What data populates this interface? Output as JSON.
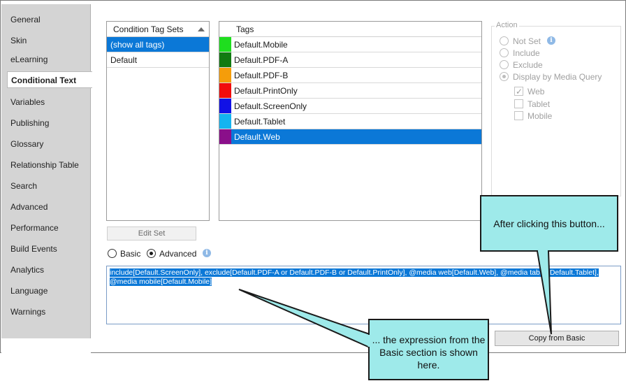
{
  "sidebar": {
    "items": [
      {
        "label": "General"
      },
      {
        "label": "Skin"
      },
      {
        "label": "eLearning"
      },
      {
        "label": "Conditional Text",
        "active": true
      },
      {
        "label": "Variables"
      },
      {
        "label": "Publishing"
      },
      {
        "label": "Glossary"
      },
      {
        "label": "Relationship Table"
      },
      {
        "label": "Search"
      },
      {
        "label": "Advanced"
      },
      {
        "label": "Performance"
      },
      {
        "label": "Build Events"
      },
      {
        "label": "Analytics"
      },
      {
        "label": "Language"
      },
      {
        "label": "Warnings"
      }
    ]
  },
  "tag_sets": {
    "header": "Condition Tag Sets",
    "rows": [
      "(show all tags)",
      "Default"
    ],
    "selected": "(show all tags)"
  },
  "tags": {
    "header": "Tags",
    "rows": [
      {
        "label": "Default.Mobile",
        "color": "#1fde1f"
      },
      {
        "label": "Default.PDF-A",
        "color": "#117a11"
      },
      {
        "label": "Default.PDF-B",
        "color": "#f59d0a"
      },
      {
        "label": "Default.PrintOnly",
        "color": "#f10c0c"
      },
      {
        "label": "Default.ScreenOnly",
        "color": "#1111e6"
      },
      {
        "label": "Default.Tablet",
        "color": "#14b4f0"
      },
      {
        "label": "Default.Web",
        "color": "#8a0f8a"
      }
    ],
    "selected": "Default.Web"
  },
  "action": {
    "legend": "Action",
    "options": [
      {
        "label": "Not Set",
        "checked": false
      },
      {
        "label": "Include",
        "checked": false
      },
      {
        "label": "Exclude",
        "checked": false
      },
      {
        "label": "Display by Media Query",
        "checked": true
      }
    ],
    "media": [
      {
        "label": "Web",
        "checked": true
      },
      {
        "label": "Tablet",
        "checked": false
      },
      {
        "label": "Mobile",
        "checked": false
      }
    ]
  },
  "edit_set_label": "Edit Set",
  "mode": {
    "basic_label": "Basic",
    "advanced_label": "Advanced",
    "selected": "Advanced"
  },
  "expression": "include[Default.ScreenOnly], exclude[Default.PDF-A or Default.PDF-B or Default.PrintOnly], @media web[Default.Web], @media tablet[Default.Tablet], @media mobile[Default.Mobile]",
  "copy_from_basic_label": "Copy from Basic",
  "callouts": {
    "top": "After clicking this button...",
    "bottom": "... the expression from the Basic section is shown here."
  },
  "colors": {
    "selection": "#0b78d7",
    "callout_fill": "#9eeaea"
  }
}
